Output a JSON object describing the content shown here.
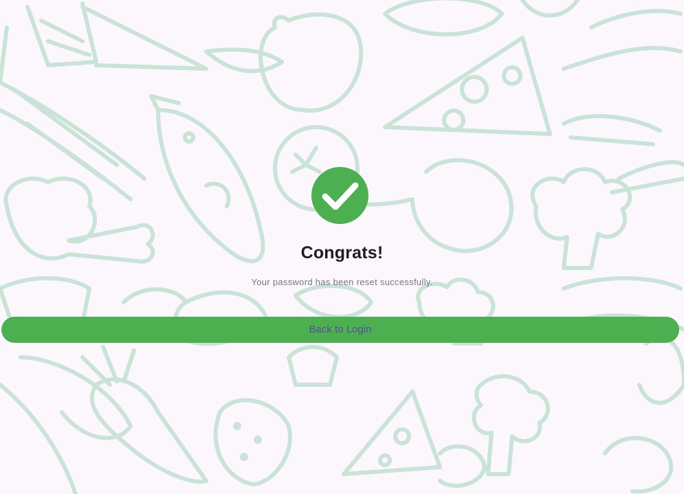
{
  "background": {
    "pattern_icon": "food-doodle-pattern",
    "color": "#fbf7fc",
    "doodle_color": "#c9e4d6"
  },
  "status_icon": {
    "name": "check-circle-icon",
    "color": "#4caf50"
  },
  "title": "Congrats!",
  "message": "Your password has been reset successfully.",
  "actions": {
    "back_to_login_label": "Back to Login",
    "button_color": "#4caf50",
    "label_color": "#5b4a9e"
  }
}
